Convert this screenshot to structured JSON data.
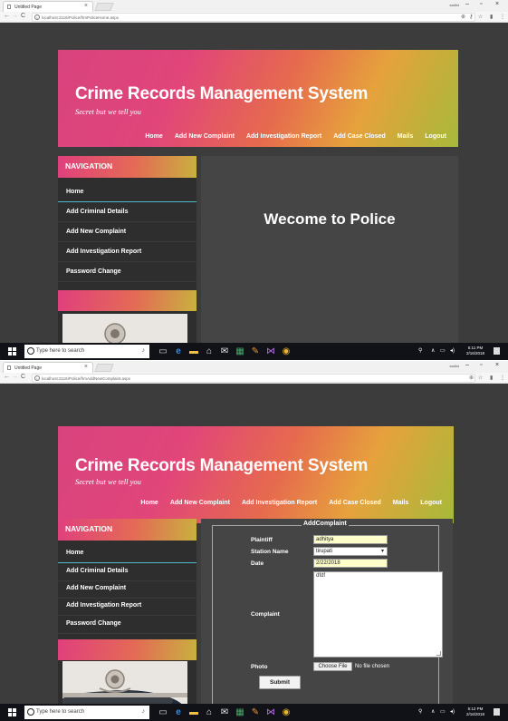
{
  "browser": {
    "tab_title": "Untitled Page",
    "user_label": "sadist",
    "screen1_url": "localhost:2116/Police/frmPoliceHome.aspx",
    "screen2_url": "localhost:2116/Police/frmAddNewComplaint.aspx"
  },
  "site": {
    "title": "Crime Records Management System",
    "tagline": "Secret but we tell you",
    "menu": [
      "Home",
      "Add New Complaint",
      "Add Investigation Report",
      "Add Case Closed",
      "Mails",
      "Logout"
    ]
  },
  "sidebar": {
    "heading": "NAVIGATION",
    "items": [
      "Home",
      "Add Criminal Details",
      "Add New Complaint",
      "Add Investigation Report",
      "Password Change"
    ]
  },
  "home": {
    "welcome": "Wecome to Police"
  },
  "complaint_form": {
    "legend": "AddComplaint",
    "plaintiff_label": "Plaintiff",
    "plaintiff_value": "adhitya",
    "station_label": "Station Name",
    "station_value": "tirupati",
    "date_label": "Date",
    "date_value": "2/22/2018",
    "complaint_label": "Complaint",
    "complaint_value": "dfdf",
    "photo_label": "Photo",
    "choose_file_label": "Choose File",
    "file_status": "No file chosen",
    "submit_label": "Submit"
  },
  "taskbar": {
    "search_placeholder": "Type here to search",
    "screen1_time": "5:11 PM",
    "screen1_date": "2/16/2018",
    "screen2_time": "5:12 PM",
    "screen2_date": "2/16/2018"
  },
  "colors": {
    "page_bg": "#3c3c3c",
    "content_bg": "#454545",
    "sidebar_bg": "#2e2e2e",
    "header_gradient": [
      "#d8437e",
      "#e66a4e",
      "#e6a23c",
      "#a6ba3a"
    ],
    "input_bg": "#ffffcc",
    "active_underline": "#4fb8c8"
  },
  "icons": [
    "page-icon",
    "back-icon",
    "forward-icon",
    "reload-icon",
    "info-icon",
    "zoom-icon",
    "key-icon",
    "star-icon",
    "extension-icon",
    "menu-icon",
    "windows-start-icon",
    "search-icon",
    "mic-icon",
    "task-view-icon",
    "edge-icon",
    "file-explorer-icon",
    "store-icon",
    "mail-icon",
    "excel-icon",
    "paint-icon",
    "visual-studio-icon",
    "chrome-icon"
  ]
}
